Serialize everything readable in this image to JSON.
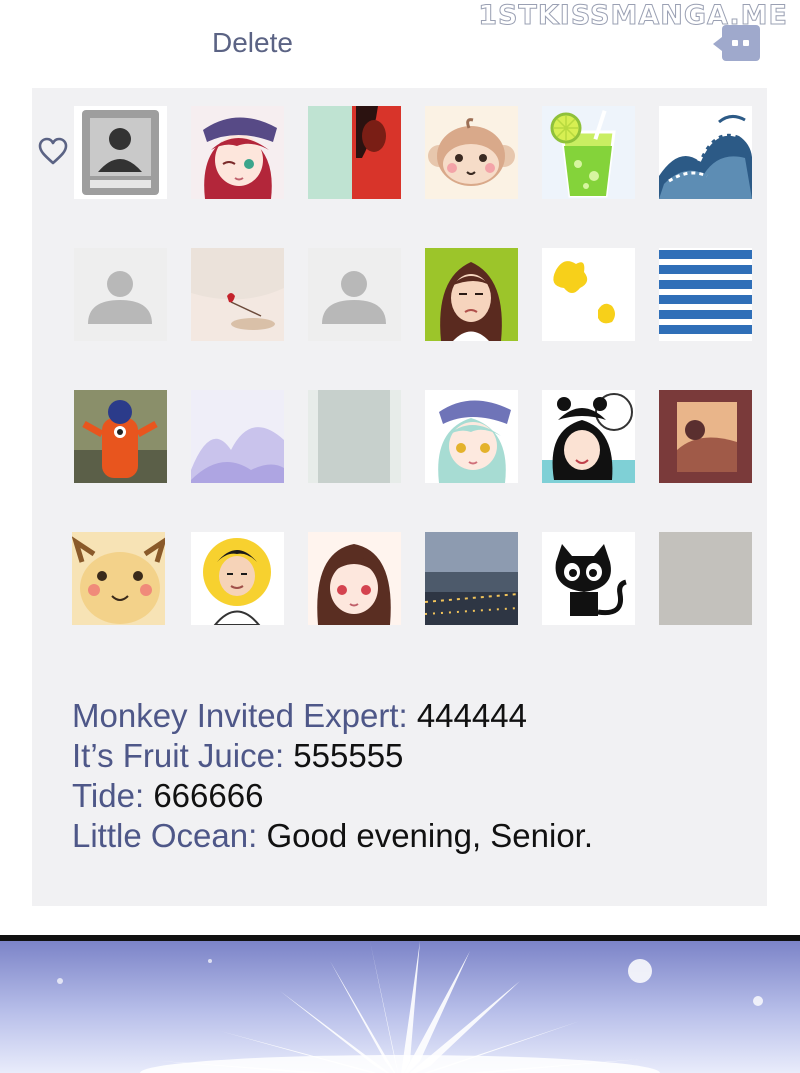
{
  "watermark": "1STKISSMANGA.ME",
  "header": {
    "delete_label": "Delete",
    "chat_icon": "chat-bubble-icon"
  },
  "favorite_icon": "heart-icon",
  "avatars": [
    [
      "default-portrait-dark",
      "anime-girl-red-hair-sailor-cap",
      "split-green-red-photo",
      "monkey-cartoon",
      "lime-juice-drink",
      "great-wave-art"
    ],
    [
      "default-person-gray",
      "red-flower-photo",
      "default-person-gray",
      "woman-cartoon-green",
      "yellow-blobs",
      "blue-stripes"
    ],
    [
      "orange-figure-toy",
      "lavender-mist",
      "gray-panel",
      "anime-girl-teal-hair-sailor-cap",
      "panda-hat-girl",
      "sunset-window-photo"
    ],
    [
      "cartoon-deer",
      "man-cartoon-sun",
      "anime-girl-brown-hair",
      "city-river-night-photo",
      "black-cat-cartoon",
      "gray-square"
    ]
  ],
  "messages": [
    {
      "name": "Monkey Invited Expert:",
      "text": "444444"
    },
    {
      "name": "It’s Fruit Juice:",
      "text": "555555"
    },
    {
      "name": "Tide:",
      "text": "666666"
    },
    {
      "name": "Little Ocean:",
      "text": "Good evening, Senior."
    }
  ],
  "colors": {
    "panel_bg": "#f1f1f3",
    "name_color": "#4e5788",
    "accent": "#9fa9cc"
  }
}
